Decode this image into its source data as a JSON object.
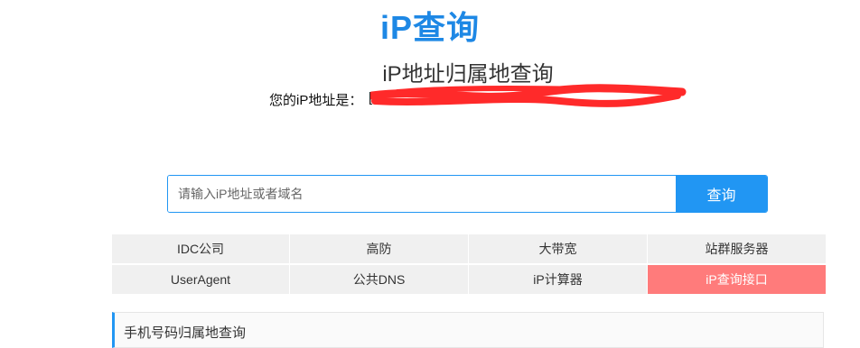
{
  "header": {
    "logo": "iP查询",
    "title": "iP地址归属地查询"
  },
  "ip_info": {
    "label": "您的iP地址是：",
    "bracket": "["
  },
  "search": {
    "placeholder": "请输入iP地址或者域名",
    "value": "",
    "button_label": "查询"
  },
  "nav": {
    "items": [
      {
        "label": "IDC公司"
      },
      {
        "label": "高防"
      },
      {
        "label": "大带宽"
      },
      {
        "label": "站群服务器"
      },
      {
        "label": "UserAgent"
      },
      {
        "label": "公共DNS"
      },
      {
        "label": "iP计算器"
      },
      {
        "label": "iP查询接口"
      }
    ]
  },
  "section": {
    "title": "手机号码归属地查询"
  },
  "colors": {
    "accent": "#2196f3",
    "logo": "#1e88e5",
    "active": "#ff7b7b",
    "redaction": "#ff2a2a"
  }
}
